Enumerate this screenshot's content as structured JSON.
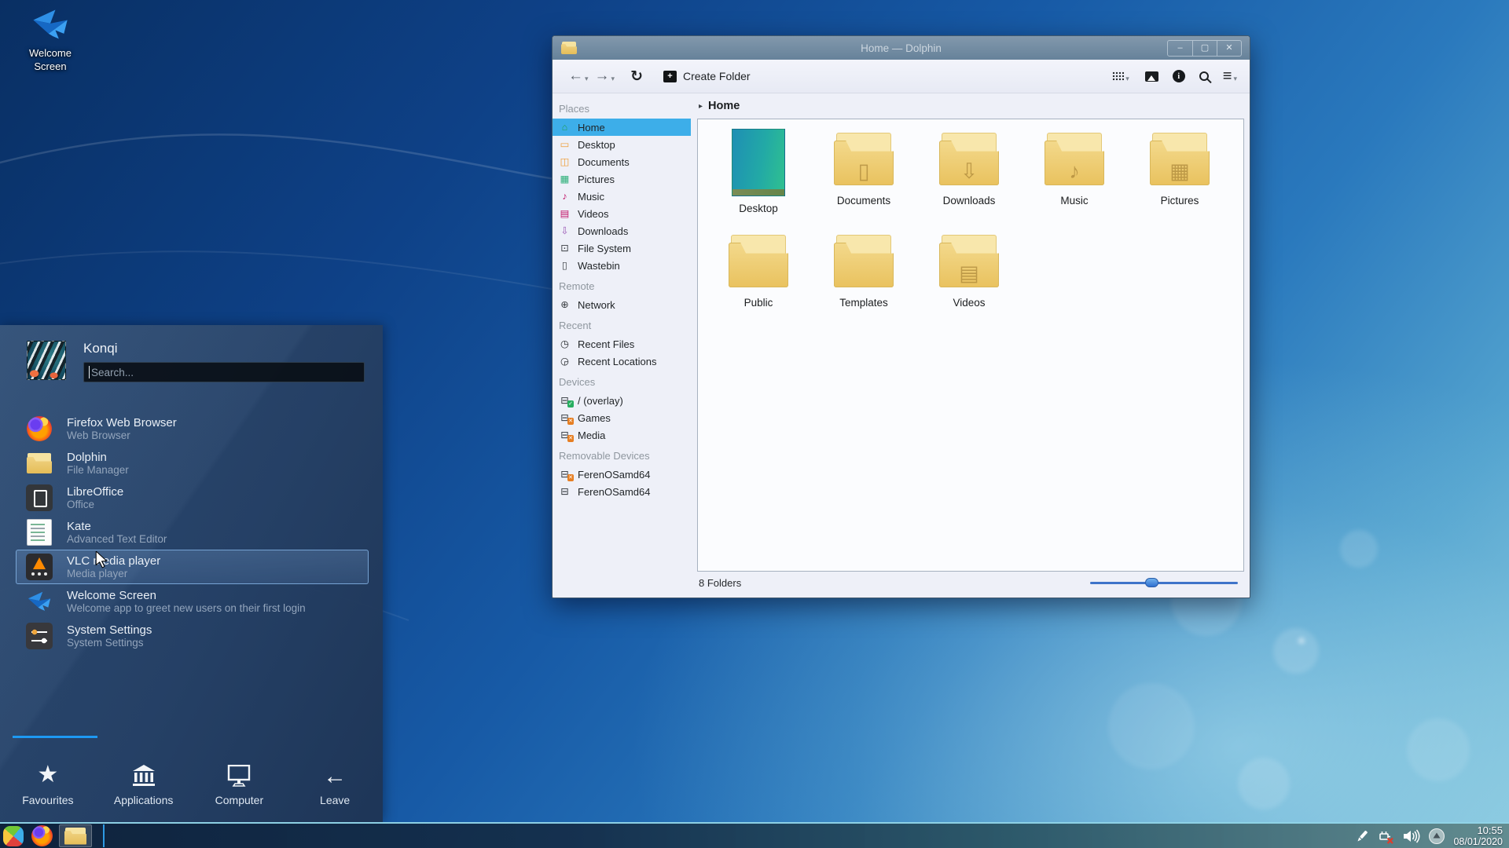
{
  "desktop": {
    "icon": {
      "line1": "Welcome",
      "line2": "Screen"
    }
  },
  "window": {
    "title": "Home — Dolphin",
    "controls": {
      "minimize": "–",
      "maximize": "▢",
      "close": "✕"
    },
    "toolbar": {
      "back": "←",
      "forward": "→",
      "caret": "▾",
      "refresh": "↻",
      "create_folder_plus": "+",
      "create_folder_label": "Create Folder",
      "menu": "≡",
      "info_i": "i"
    },
    "breadcrumb": {
      "arrow": "▸",
      "label": "Home"
    },
    "sidebar": {
      "selected_item": "Home",
      "sections": [
        {
          "header": "Places",
          "items": [
            {
              "label": "Home",
              "glyph": "⌂"
            },
            {
              "label": "Desktop",
              "glyph": "▭"
            },
            {
              "label": "Documents",
              "glyph": "◫"
            },
            {
              "label": "Pictures",
              "glyph": "▦"
            },
            {
              "label": "Music",
              "glyph": "♪"
            },
            {
              "label": "Videos",
              "glyph": "▤"
            },
            {
              "label": "Downloads",
              "glyph": "⇩"
            },
            {
              "label": "File System",
              "glyph": "⊡"
            },
            {
              "label": "Wastebin",
              "glyph": "▯"
            }
          ]
        },
        {
          "header": "Remote",
          "items": [
            {
              "label": "Network",
              "glyph": "⊕"
            }
          ]
        },
        {
          "header": "Recent",
          "items": [
            {
              "label": "Recent Files",
              "glyph": "◷"
            },
            {
              "label": "Recent Locations",
              "glyph": "◶"
            }
          ]
        },
        {
          "header": "Devices",
          "items": [
            {
              "label": "/ (overlay)",
              "glyph": "⊟",
              "badge": "✓"
            },
            {
              "label": "Games",
              "glyph": "⊟",
              "badge": "✕"
            },
            {
              "label": "Media",
              "glyph": "⊟",
              "badge": "✕"
            }
          ]
        },
        {
          "header": "Removable Devices",
          "items": [
            {
              "label": "FerenOSamd64",
              "glyph": "⊟",
              "badge": "✕"
            },
            {
              "label": "FerenOSamd64",
              "glyph": "⊟"
            }
          ]
        }
      ]
    },
    "files": {
      "folders": [
        {
          "name": "Desktop",
          "kind": "thumbnail"
        },
        {
          "name": "Documents",
          "glyph": "▯"
        },
        {
          "name": "Downloads",
          "glyph": "⇩"
        },
        {
          "name": "Music",
          "glyph": "♪"
        },
        {
          "name": "Pictures",
          "glyph": "▦"
        },
        {
          "name": "Public",
          "glyph": ""
        },
        {
          "name": "Templates",
          "glyph": ""
        },
        {
          "name": "Videos",
          "glyph": "▤"
        }
      ]
    },
    "statusbar": {
      "text": "8 Folders",
      "zoom_slider_percent": 37
    }
  },
  "launcher": {
    "user_name": "Konqi",
    "search_placeholder": "Search...",
    "apps": [
      {
        "name": "Firefox Web Browser",
        "desc": "Web Browser"
      },
      {
        "name": "Dolphin",
        "desc": "File Manager"
      },
      {
        "name": "LibreOffice",
        "desc": "Office"
      },
      {
        "name": "Kate",
        "desc": "Advanced Text Editor"
      },
      {
        "name": "VLC media player",
        "desc": "Media player",
        "highlighted": true
      },
      {
        "name": "Welcome Screen",
        "desc": "Welcome app to greet new users on their first login"
      },
      {
        "name": "System Settings",
        "desc": "System Settings"
      }
    ],
    "tabs": [
      {
        "label": "Favourites",
        "active": true
      },
      {
        "label": "Applications"
      },
      {
        "label": "Computer"
      },
      {
        "label": "Leave"
      }
    ],
    "star_glyph": "★",
    "leave_glyph": "←"
  },
  "taskbar": {
    "clock": {
      "time": "10:55",
      "date": "08/01/2020"
    }
  },
  "colors": {
    "selection": "#3daee9",
    "accent": "#1d99f3",
    "folder_yellow": "#eecd75",
    "titlebar": "#71899e",
    "panel_top_border": "#94d8ec"
  }
}
